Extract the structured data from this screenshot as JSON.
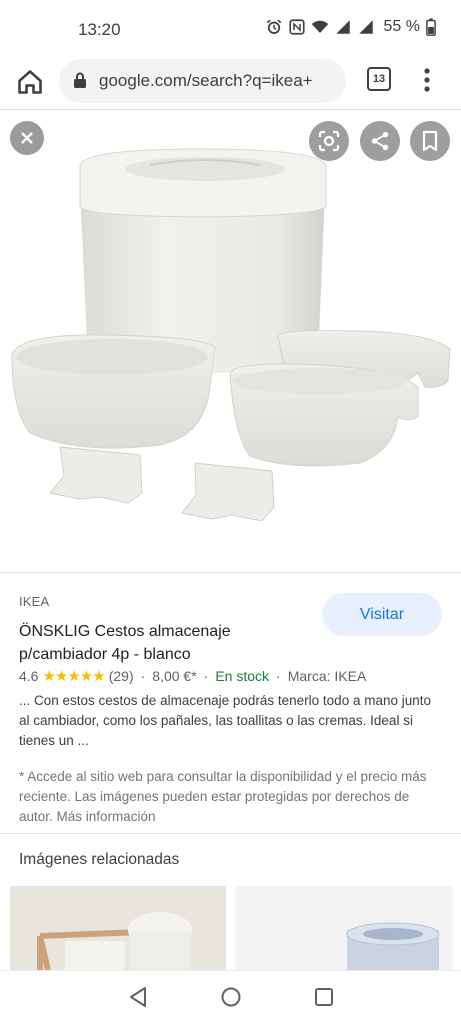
{
  "status_bar": {
    "time": "13:20",
    "battery": "55 %",
    "icons": [
      "alarm-icon",
      "nfc-icon",
      "wifi-icon",
      "signal-icon",
      "signal-icon",
      "battery-icon"
    ]
  },
  "browser": {
    "url": "google.com/search?q=ikea+",
    "tab_count": "13",
    "icons": [
      "home-icon",
      "lock-icon",
      "tabs-icon",
      "more-vert-icon"
    ]
  },
  "image_viewer": {
    "buttons": [
      "close-icon",
      "google-lens-icon",
      "share-icon",
      "bookmark-icon"
    ]
  },
  "result": {
    "source": "IKEA",
    "title": "ÖNSKLIG Cestos almacenaje p/cambiador 4p - blanco",
    "visit_label": "Visitar",
    "rating": "4.6",
    "stars": "★★★★★",
    "reviews": "(29)",
    "price": "8,00 €*",
    "availability": "En stock",
    "brand": "Marca: IKEA",
    "separator": "·",
    "description": "... Con estos cestos de almacenaje podrás tenerlo todo a mano junto al cambiador, como los pañales, las toallitas o las cremas. Ideal si tienes un ...",
    "disclaimer": "* Accede al sitio web para consultar la disponibilidad y el precio más reciente. Las imágenes pueden estar protegidas por derechos de autor. Más información"
  },
  "related": {
    "title": "Imágenes relacionadas"
  },
  "colors": {
    "accent": "#1a73e8",
    "visit_bg": "#e8f0fe",
    "stars": "#fbbc04",
    "in_stock": "#188038"
  }
}
